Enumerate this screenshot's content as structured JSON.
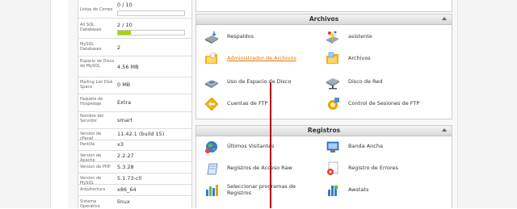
{
  "stats": {
    "rows": [
      {
        "label": "Listas de Correo",
        "value": "0 / 10"
      },
      {
        "label": "All SQL Databases",
        "value": "2 / 10",
        "bar_fraction": 0.2
      },
      {
        "label": "MySQL Databases",
        "value": "2"
      },
      {
        "label": "Espacio de Disco de MySQL",
        "value": "4.56 MB"
      },
      {
        "label": "Mailing List Disk Space",
        "value": "0 MB"
      },
      {
        "label": "Paquete de Hospedaje",
        "value": "Extra"
      },
      {
        "label": "Nombre del Servidor",
        "value": "smart"
      },
      {
        "label": "Versión de cPanel",
        "value": "11.42.1 (build 15)"
      },
      {
        "label": "Pantilla",
        "value": "x3"
      },
      {
        "label": "Version de Apache",
        "value": "2.2.27"
      },
      {
        "label": "Version de PHP",
        "value": "5.3.28"
      },
      {
        "label": "Version de MySQL",
        "value": "5.1.73-cll"
      },
      {
        "label": "Arquitectura",
        "value": "x86_64"
      },
      {
        "label": "Sistema Operativo",
        "value": "linux"
      }
    ]
  },
  "archivos": {
    "title": "Archivos",
    "items": [
      {
        "label": "Respaldos",
        "icon": "backup-drive-icon"
      },
      {
        "label": "asistente",
        "icon": "wizard-icon"
      },
      {
        "label": "Administrador de Archivos",
        "icon": "file-manager-folder-icon"
      },
      {
        "label": "Archivos",
        "icon": "folder-icon"
      },
      {
        "label": "Uso de Espacio de Disco",
        "icon": "disk-usage-icon"
      },
      {
        "label": "Disco de Red",
        "icon": "network-disk-icon"
      },
      {
        "label": "Cuentas de FTP",
        "icon": "ftp-accounts-icon"
      },
      {
        "label": "Control de Sesiones de FTP",
        "icon": "ftp-sessions-icon"
      }
    ]
  },
  "registros": {
    "title": "Registros",
    "items": [
      {
        "label": "Últimos Visitantes",
        "icon": "latest-visitors-icon"
      },
      {
        "label": "Banda Ancha",
        "icon": "bandwidth-icon"
      },
      {
        "label": "Registros de Acceso Raw",
        "icon": "raw-access-icon"
      },
      {
        "label": "Registro de Errores",
        "icon": "error-log-icon"
      },
      {
        "label": "Seleccionar programas de Registros",
        "icon": "log-programs-icon"
      },
      {
        "label": "Awstats",
        "icon": "awstats-icon"
      }
    ]
  },
  "colors": {
    "accent_link": "#e27a00",
    "bar_fill": "#a6d400",
    "cursor_line": "#b00000"
  }
}
